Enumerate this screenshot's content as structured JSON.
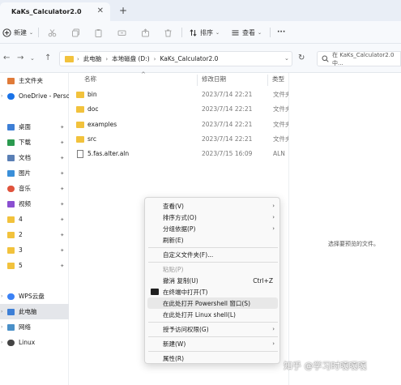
{
  "window": {
    "tab_title": "KaKs_Calculator2.0",
    "tab_close": "✕",
    "tab_add": "+"
  },
  "toolbar": {
    "new_label": "新建",
    "sort_label": "排序",
    "view_label": "查看",
    "more_label": "···"
  },
  "address": {
    "back": "←",
    "forward": "→",
    "up": "↑",
    "breadcrumbs": [
      "此电脑",
      "本地磁盘 (D:)",
      "KaKs_Calculator2.0"
    ],
    "refresh": "↻",
    "search_placeholder": "在 KaKs_Calculator2.0 中..."
  },
  "sidebar": {
    "items": [
      {
        "label": "主文件夹",
        "icon": "home-icon",
        "color": "#e07b39"
      },
      {
        "label": "OneDrive - Perso",
        "icon": "onedrive-icon",
        "color": "#1a73e8"
      },
      {
        "label": "桌面",
        "icon": "desktop-icon",
        "color": "#3d7fd6",
        "pin": "📌"
      },
      {
        "label": "下载",
        "icon": "download-icon",
        "color": "#2b9a4f",
        "pin": "📌"
      },
      {
        "label": "文档",
        "icon": "documents-icon",
        "color": "#5a7fb5",
        "pin": "📌"
      },
      {
        "label": "图片",
        "icon": "pictures-icon",
        "color": "#3a8fd9",
        "pin": "📌"
      },
      {
        "label": "音乐",
        "icon": "music-icon",
        "color": "#e0533c",
        "pin": "📌"
      },
      {
        "label": "视频",
        "icon": "videos-icon",
        "color": "#8a4fd1",
        "pin": "📌"
      },
      {
        "label": "4",
        "icon": "folder-icon",
        "color": "#f2c23c",
        "pin": "📌"
      },
      {
        "label": "2",
        "icon": "folder-icon",
        "color": "#f2c23c",
        "pin": "📌"
      },
      {
        "label": "3",
        "icon": "folder-icon",
        "color": "#f2c23c",
        "pin": "📌"
      },
      {
        "label": "5",
        "icon": "folder-icon",
        "color": "#f2c23c",
        "pin": "📌"
      },
      {
        "label": "WPS云盘",
        "icon": "wps-cloud-icon",
        "color": "#3b82f6"
      },
      {
        "label": "此电脑",
        "icon": "this-pc-icon",
        "color": "#3d7fd6",
        "active": true
      },
      {
        "label": "网络",
        "icon": "network-icon",
        "color": "#4a90c8"
      },
      {
        "label": "Linux",
        "icon": "linux-icon",
        "color": "#444444"
      }
    ]
  },
  "columns": {
    "name": "名称",
    "date": "修改日期",
    "type": "类型"
  },
  "files": [
    {
      "name": "bin",
      "date": "2023/7/14 22:21",
      "type": "文件夹",
      "kind": "folder"
    },
    {
      "name": "doc",
      "date": "2023/7/14 22:21",
      "type": "文件夹",
      "kind": "folder"
    },
    {
      "name": "examples",
      "date": "2023/7/14 22:21",
      "type": "文件夹",
      "kind": "folder"
    },
    {
      "name": "src",
      "date": "2023/7/14 22:21",
      "type": "文件夹",
      "kind": "folder"
    },
    {
      "name": "5.fas.alter.aln",
      "date": "2023/7/15 16:09",
      "type": "ALN",
      "kind": "file"
    }
  ],
  "preview": {
    "empty_text": "选择要预览的文件。"
  },
  "context_menu": {
    "items": [
      {
        "label": "查看(V)",
        "submenu": true
      },
      {
        "label": "排序方式(O)",
        "submenu": true
      },
      {
        "label": "分组依据(P)",
        "submenu": true
      },
      {
        "label": "刷新(E)"
      },
      {
        "label": "自定义文件夹(F)..."
      },
      {
        "label": "粘贴(P)",
        "disabled": true
      },
      {
        "label": "撤消 复制(U)",
        "shortcut": "Ctrl+Z"
      },
      {
        "label": "在终端中打开(T)",
        "icon": "terminal-icon"
      },
      {
        "label": "在此处打开 Powershell 窗口(S)",
        "highlighted": true
      },
      {
        "label": "在此处打开 Linux shell(L)"
      },
      {
        "label": "授予访问权限(G)",
        "submenu": true
      },
      {
        "label": "新建(W)",
        "submenu": true
      },
      {
        "label": "属性(R)"
      }
    ],
    "arrow": "›"
  },
  "watermark": "知乎 @学习时嘎嘎嘎"
}
